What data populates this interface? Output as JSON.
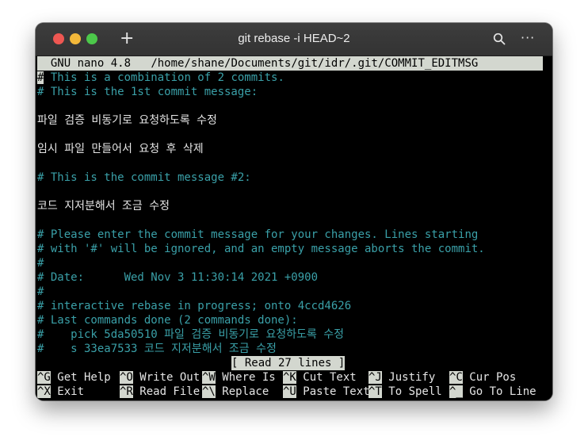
{
  "window": {
    "title": "git rebase -i HEAD~2",
    "new_tab_glyph": "+",
    "more_glyph": "···",
    "traffic_lights": {
      "close": "#ee5752",
      "minimize": "#f3b83a",
      "zoom": "#4cc84a"
    }
  },
  "nano": {
    "header_app": "GNU nano 4.8",
    "header_file": "/home/shane/Documents/git/idr/.git/COMMIT_EDITMSG",
    "cursor_char": "#",
    "status": "[ Read 27 lines ]"
  },
  "editor": {
    "lines": [
      {
        "text": " This is a combination of 2 commits.",
        "kind": "comment-cursor"
      },
      {
        "text": "# This is the 1st commit message:",
        "kind": "comment"
      },
      {
        "text": "",
        "kind": "text"
      },
      {
        "text": "파일 검증 비동기로 요청하도록 수정",
        "kind": "text"
      },
      {
        "text": "",
        "kind": "text"
      },
      {
        "text": "임시 파일 만들어서 요청 후 삭제",
        "kind": "text"
      },
      {
        "text": "",
        "kind": "text"
      },
      {
        "text": "# This is the commit message #2:",
        "kind": "comment"
      },
      {
        "text": "",
        "kind": "text"
      },
      {
        "text": "코드 지저분해서 조금 수정",
        "kind": "text"
      },
      {
        "text": "",
        "kind": "text"
      },
      {
        "text": "# Please enter the commit message for your changes. Lines starting",
        "kind": "comment"
      },
      {
        "text": "# with '#' will be ignored, and an empty message aborts the commit.",
        "kind": "comment"
      },
      {
        "text": "#",
        "kind": "comment"
      },
      {
        "text": "# Date:      Wed Nov 3 11:30:14 2021 +0900",
        "kind": "comment"
      },
      {
        "text": "#",
        "kind": "comment"
      },
      {
        "text": "# interactive rebase in progress; onto 4ccd4626",
        "kind": "comment"
      },
      {
        "text": "# Last commands done (2 commands done):",
        "kind": "comment"
      },
      {
        "text": "#    pick 5da50510 파일 검증 비동기로 요청하도록 수정",
        "kind": "comment"
      },
      {
        "text": "#    s 33ea7533 코드 지저분해서 조금 수정",
        "kind": "comment"
      }
    ]
  },
  "shortcuts": {
    "row1": [
      {
        "key": "^G",
        "label": "Get Help"
      },
      {
        "key": "^O",
        "label": "Write Out"
      },
      {
        "key": "^W",
        "label": "Where Is"
      },
      {
        "key": "^K",
        "label": "Cut Text"
      },
      {
        "key": "^J",
        "label": "Justify"
      },
      {
        "key": "^C",
        "label": "Cur Pos"
      }
    ],
    "row2": [
      {
        "key": "^X",
        "label": "Exit"
      },
      {
        "key": "^R",
        "label": "Read File"
      },
      {
        "key": "^\\",
        "label": "Replace"
      },
      {
        "key": "^U",
        "label": "Paste Text"
      },
      {
        "key": "^T",
        "label": "To Spell"
      },
      {
        "key": "^_",
        "label": "Go To Line"
      }
    ]
  }
}
